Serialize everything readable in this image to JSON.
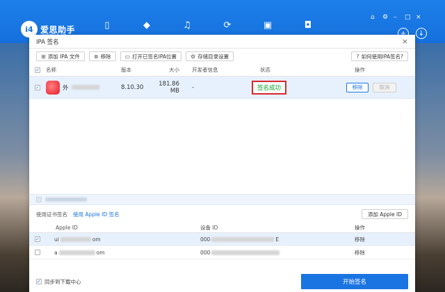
{
  "app": {
    "logo_mark": "i4",
    "logo_text": "爱思助手",
    "logo_url": "www.i4.cn"
  },
  "dialog": {
    "title": "IPA 签名",
    "close_symbol": "×"
  },
  "toolbar": {
    "add_ipa": "添加 IPA 文件",
    "remove": "移除",
    "open_folder": "打开已签名IPA位置",
    "save_dir": "存储目录设置",
    "help": "如何使用IPA签名?"
  },
  "table": {
    "headers": {
      "name": "名称",
      "version": "版本",
      "size": "大小",
      "developer": "开发者信息",
      "status": "状态",
      "action": "操作"
    },
    "rows": [
      {
        "name_prefix": "外",
        "version": "8.10.30",
        "size": "181.86 MB",
        "developer": "-",
        "status": "签名成功",
        "remove": "移除",
        "cancel": "取消"
      }
    ]
  },
  "sign": {
    "tab_cert": "使用证书签名",
    "tab_apple": "使用 Apple ID 签名",
    "add_apple_id": "添加 Apple ID",
    "headers": {
      "apple_id": "Apple ID",
      "device_id": "设备 ID",
      "action": "操作"
    },
    "rows": [
      {
        "id_prefix": "ui",
        "id_suffix": "om",
        "device_prefix": "000",
        "device_suffix": "E",
        "action": "移除",
        "checked": "✓"
      },
      {
        "id_prefix": "a",
        "id_suffix": "om",
        "device_prefix": "000",
        "device_suffix": "",
        "action": "移除",
        "checked": ""
      }
    ]
  },
  "footer": {
    "sync": "同步到下载中心",
    "start": "开始签名"
  },
  "colors": {
    "accent": "#1a74e2",
    "success": "#1ea63a",
    "highlight_border": "#d9262e"
  }
}
